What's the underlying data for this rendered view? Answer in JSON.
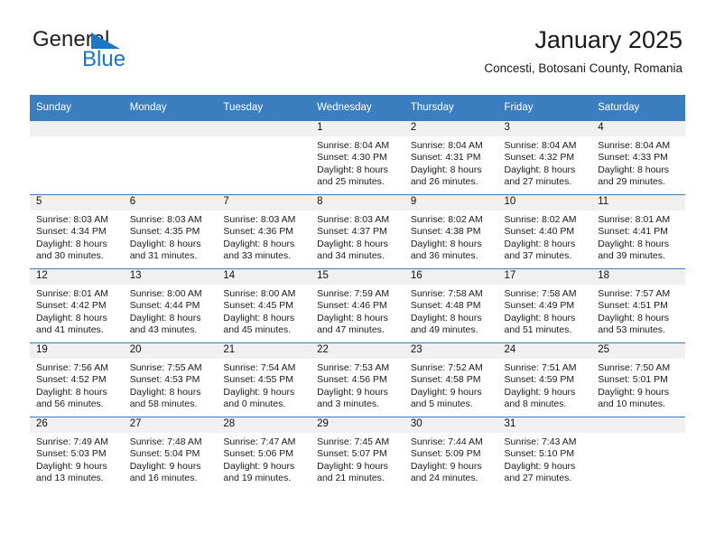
{
  "brand": {
    "name_part1": "General",
    "name_part2": "Blue",
    "flag_icon": "blue-triangle-flag-icon",
    "accent_color": "#1d76c4"
  },
  "header": {
    "title": "January 2025",
    "subtitle": "Concesti, Botosani County, Romania"
  },
  "theme": {
    "header_row_color": "#3a7ebf",
    "daynum_band_color": "#f0f0f0",
    "text_color": "#1a1a1a"
  },
  "calendar": {
    "weekday_headers": [
      "Sunday",
      "Monday",
      "Tuesday",
      "Wednesday",
      "Thursday",
      "Friday",
      "Saturday"
    ],
    "weeks": [
      [
        {
          "day": "",
          "sunrise": "",
          "sunset": "",
          "daylight_line1": "",
          "daylight_line2": ""
        },
        {
          "day": "",
          "sunrise": "",
          "sunset": "",
          "daylight_line1": "",
          "daylight_line2": ""
        },
        {
          "day": "",
          "sunrise": "",
          "sunset": "",
          "daylight_line1": "",
          "daylight_line2": ""
        },
        {
          "day": "1",
          "sunrise": "Sunrise: 8:04 AM",
          "sunset": "Sunset: 4:30 PM",
          "daylight_line1": "Daylight: 8 hours",
          "daylight_line2": "and 25 minutes."
        },
        {
          "day": "2",
          "sunrise": "Sunrise: 8:04 AM",
          "sunset": "Sunset: 4:31 PM",
          "daylight_line1": "Daylight: 8 hours",
          "daylight_line2": "and 26 minutes."
        },
        {
          "day": "3",
          "sunrise": "Sunrise: 8:04 AM",
          "sunset": "Sunset: 4:32 PM",
          "daylight_line1": "Daylight: 8 hours",
          "daylight_line2": "and 27 minutes."
        },
        {
          "day": "4",
          "sunrise": "Sunrise: 8:04 AM",
          "sunset": "Sunset: 4:33 PM",
          "daylight_line1": "Daylight: 8 hours",
          "daylight_line2": "and 29 minutes."
        }
      ],
      [
        {
          "day": "5",
          "sunrise": "Sunrise: 8:03 AM",
          "sunset": "Sunset: 4:34 PM",
          "daylight_line1": "Daylight: 8 hours",
          "daylight_line2": "and 30 minutes."
        },
        {
          "day": "6",
          "sunrise": "Sunrise: 8:03 AM",
          "sunset": "Sunset: 4:35 PM",
          "daylight_line1": "Daylight: 8 hours",
          "daylight_line2": "and 31 minutes."
        },
        {
          "day": "7",
          "sunrise": "Sunrise: 8:03 AM",
          "sunset": "Sunset: 4:36 PM",
          "daylight_line1": "Daylight: 8 hours",
          "daylight_line2": "and 33 minutes."
        },
        {
          "day": "8",
          "sunrise": "Sunrise: 8:03 AM",
          "sunset": "Sunset: 4:37 PM",
          "daylight_line1": "Daylight: 8 hours",
          "daylight_line2": "and 34 minutes."
        },
        {
          "day": "9",
          "sunrise": "Sunrise: 8:02 AM",
          "sunset": "Sunset: 4:38 PM",
          "daylight_line1": "Daylight: 8 hours",
          "daylight_line2": "and 36 minutes."
        },
        {
          "day": "10",
          "sunrise": "Sunrise: 8:02 AM",
          "sunset": "Sunset: 4:40 PM",
          "daylight_line1": "Daylight: 8 hours",
          "daylight_line2": "and 37 minutes."
        },
        {
          "day": "11",
          "sunrise": "Sunrise: 8:01 AM",
          "sunset": "Sunset: 4:41 PM",
          "daylight_line1": "Daylight: 8 hours",
          "daylight_line2": "and 39 minutes."
        }
      ],
      [
        {
          "day": "12",
          "sunrise": "Sunrise: 8:01 AM",
          "sunset": "Sunset: 4:42 PM",
          "daylight_line1": "Daylight: 8 hours",
          "daylight_line2": "and 41 minutes."
        },
        {
          "day": "13",
          "sunrise": "Sunrise: 8:00 AM",
          "sunset": "Sunset: 4:44 PM",
          "daylight_line1": "Daylight: 8 hours",
          "daylight_line2": "and 43 minutes."
        },
        {
          "day": "14",
          "sunrise": "Sunrise: 8:00 AM",
          "sunset": "Sunset: 4:45 PM",
          "daylight_line1": "Daylight: 8 hours",
          "daylight_line2": "and 45 minutes."
        },
        {
          "day": "15",
          "sunrise": "Sunrise: 7:59 AM",
          "sunset": "Sunset: 4:46 PM",
          "daylight_line1": "Daylight: 8 hours",
          "daylight_line2": "and 47 minutes."
        },
        {
          "day": "16",
          "sunrise": "Sunrise: 7:58 AM",
          "sunset": "Sunset: 4:48 PM",
          "daylight_line1": "Daylight: 8 hours",
          "daylight_line2": "and 49 minutes."
        },
        {
          "day": "17",
          "sunrise": "Sunrise: 7:58 AM",
          "sunset": "Sunset: 4:49 PM",
          "daylight_line1": "Daylight: 8 hours",
          "daylight_line2": "and 51 minutes."
        },
        {
          "day": "18",
          "sunrise": "Sunrise: 7:57 AM",
          "sunset": "Sunset: 4:51 PM",
          "daylight_line1": "Daylight: 8 hours",
          "daylight_line2": "and 53 minutes."
        }
      ],
      [
        {
          "day": "19",
          "sunrise": "Sunrise: 7:56 AM",
          "sunset": "Sunset: 4:52 PM",
          "daylight_line1": "Daylight: 8 hours",
          "daylight_line2": "and 56 minutes."
        },
        {
          "day": "20",
          "sunrise": "Sunrise: 7:55 AM",
          "sunset": "Sunset: 4:53 PM",
          "daylight_line1": "Daylight: 8 hours",
          "daylight_line2": "and 58 minutes."
        },
        {
          "day": "21",
          "sunrise": "Sunrise: 7:54 AM",
          "sunset": "Sunset: 4:55 PM",
          "daylight_line1": "Daylight: 9 hours",
          "daylight_line2": "and 0 minutes."
        },
        {
          "day": "22",
          "sunrise": "Sunrise: 7:53 AM",
          "sunset": "Sunset: 4:56 PM",
          "daylight_line1": "Daylight: 9 hours",
          "daylight_line2": "and 3 minutes."
        },
        {
          "day": "23",
          "sunrise": "Sunrise: 7:52 AM",
          "sunset": "Sunset: 4:58 PM",
          "daylight_line1": "Daylight: 9 hours",
          "daylight_line2": "and 5 minutes."
        },
        {
          "day": "24",
          "sunrise": "Sunrise: 7:51 AM",
          "sunset": "Sunset: 4:59 PM",
          "daylight_line1": "Daylight: 9 hours",
          "daylight_line2": "and 8 minutes."
        },
        {
          "day": "25",
          "sunrise": "Sunrise: 7:50 AM",
          "sunset": "Sunset: 5:01 PM",
          "daylight_line1": "Daylight: 9 hours",
          "daylight_line2": "and 10 minutes."
        }
      ],
      [
        {
          "day": "26",
          "sunrise": "Sunrise: 7:49 AM",
          "sunset": "Sunset: 5:03 PM",
          "daylight_line1": "Daylight: 9 hours",
          "daylight_line2": "and 13 minutes."
        },
        {
          "day": "27",
          "sunrise": "Sunrise: 7:48 AM",
          "sunset": "Sunset: 5:04 PM",
          "daylight_line1": "Daylight: 9 hours",
          "daylight_line2": "and 16 minutes."
        },
        {
          "day": "28",
          "sunrise": "Sunrise: 7:47 AM",
          "sunset": "Sunset: 5:06 PM",
          "daylight_line1": "Daylight: 9 hours",
          "daylight_line2": "and 19 minutes."
        },
        {
          "day": "29",
          "sunrise": "Sunrise: 7:45 AM",
          "sunset": "Sunset: 5:07 PM",
          "daylight_line1": "Daylight: 9 hours",
          "daylight_line2": "and 21 minutes."
        },
        {
          "day": "30",
          "sunrise": "Sunrise: 7:44 AM",
          "sunset": "Sunset: 5:09 PM",
          "daylight_line1": "Daylight: 9 hours",
          "daylight_line2": "and 24 minutes."
        },
        {
          "day": "31",
          "sunrise": "Sunrise: 7:43 AM",
          "sunset": "Sunset: 5:10 PM",
          "daylight_line1": "Daylight: 9 hours",
          "daylight_line2": "and 27 minutes."
        },
        {
          "day": "",
          "sunrise": "",
          "sunset": "",
          "daylight_line1": "",
          "daylight_line2": ""
        }
      ]
    ]
  }
}
